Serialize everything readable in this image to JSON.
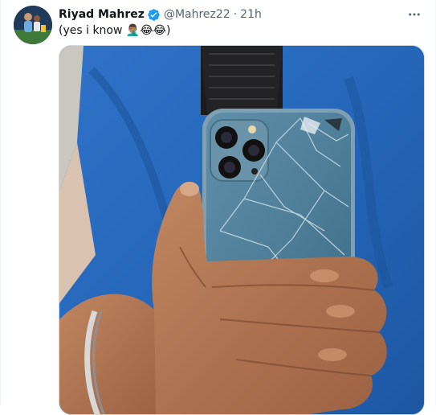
{
  "tweet": {
    "author_name": "Riyad Mahrez",
    "handle": "@Mahrez22",
    "separator": "·",
    "time": "21h",
    "text": "(yes i know 🤦🏽‍♂️😂😂)",
    "verified": true
  },
  "icons": {
    "avatar": "profile-avatar",
    "verified": "verified-badge-icon",
    "more": "more-dots-icon"
  },
  "colors": {
    "verified_blue": "#1d9bf0",
    "secondary_text": "#536471",
    "primary_text": "#0f1419",
    "border": "#cfd9de"
  },
  "media": {
    "alt": "",
    "description_visible": false
  }
}
